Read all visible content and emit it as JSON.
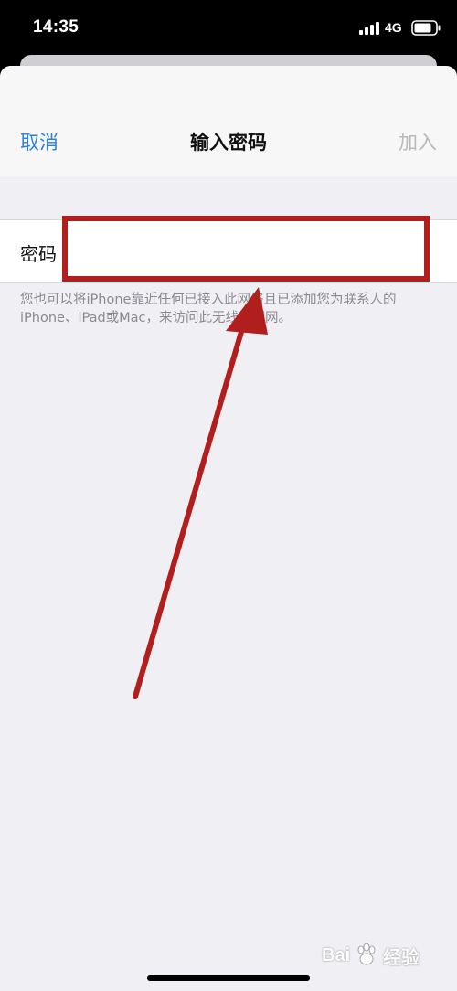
{
  "status_bar": {
    "time": "14:35",
    "network": "4G",
    "icons": [
      "signal-icon",
      "battery-icon"
    ]
  },
  "nav": {
    "cancel_label": "取消",
    "title": "输入密码",
    "join_label": "加入"
  },
  "form": {
    "password_label": "密码",
    "password_value": "",
    "footer_note": "您也可以将iPhone靠近任何已接入此网络且已添加您为联系人的iPhone、iPad或Mac，来访问此无线局域网。"
  },
  "annotation": {
    "color": "#b01e1e"
  },
  "watermark": {
    "brand": "Bai",
    "suffix": "经验",
    "icon": "paw-icon"
  },
  "colors": {
    "accent": "#2f7fd6",
    "disabled": "#b8b8bd",
    "background": "#efeff4"
  }
}
